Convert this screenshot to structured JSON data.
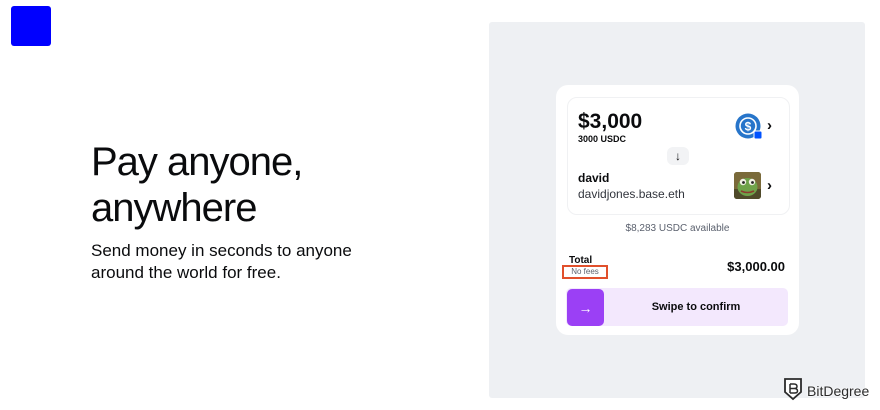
{
  "hero": {
    "title": "Pay anyone, anywhere",
    "subtitle": "Send money in seconds to anyone around the world for free."
  },
  "send_card": {
    "amount": "$3,000",
    "amount_token": "3000 USDC",
    "token_icon": "usdc-coin-icon",
    "recipient_name": "david",
    "recipient_address": "davidjones.base.eth",
    "available": "$8,283 USDC available",
    "total_label": "Total",
    "fees_label": "No fees",
    "total_value": "$3,000.00",
    "swipe_label": "Swipe to confirm"
  },
  "watermark": {
    "text": "BitDegree"
  },
  "colors": {
    "logo": "#0000ff",
    "swipe_handle": "#9b40f5",
    "swipe_track": "#f3e8fd",
    "highlight_box": "#e1502c",
    "panel_bg": "#eef0f3",
    "usdc_blue": "#2775ca"
  }
}
